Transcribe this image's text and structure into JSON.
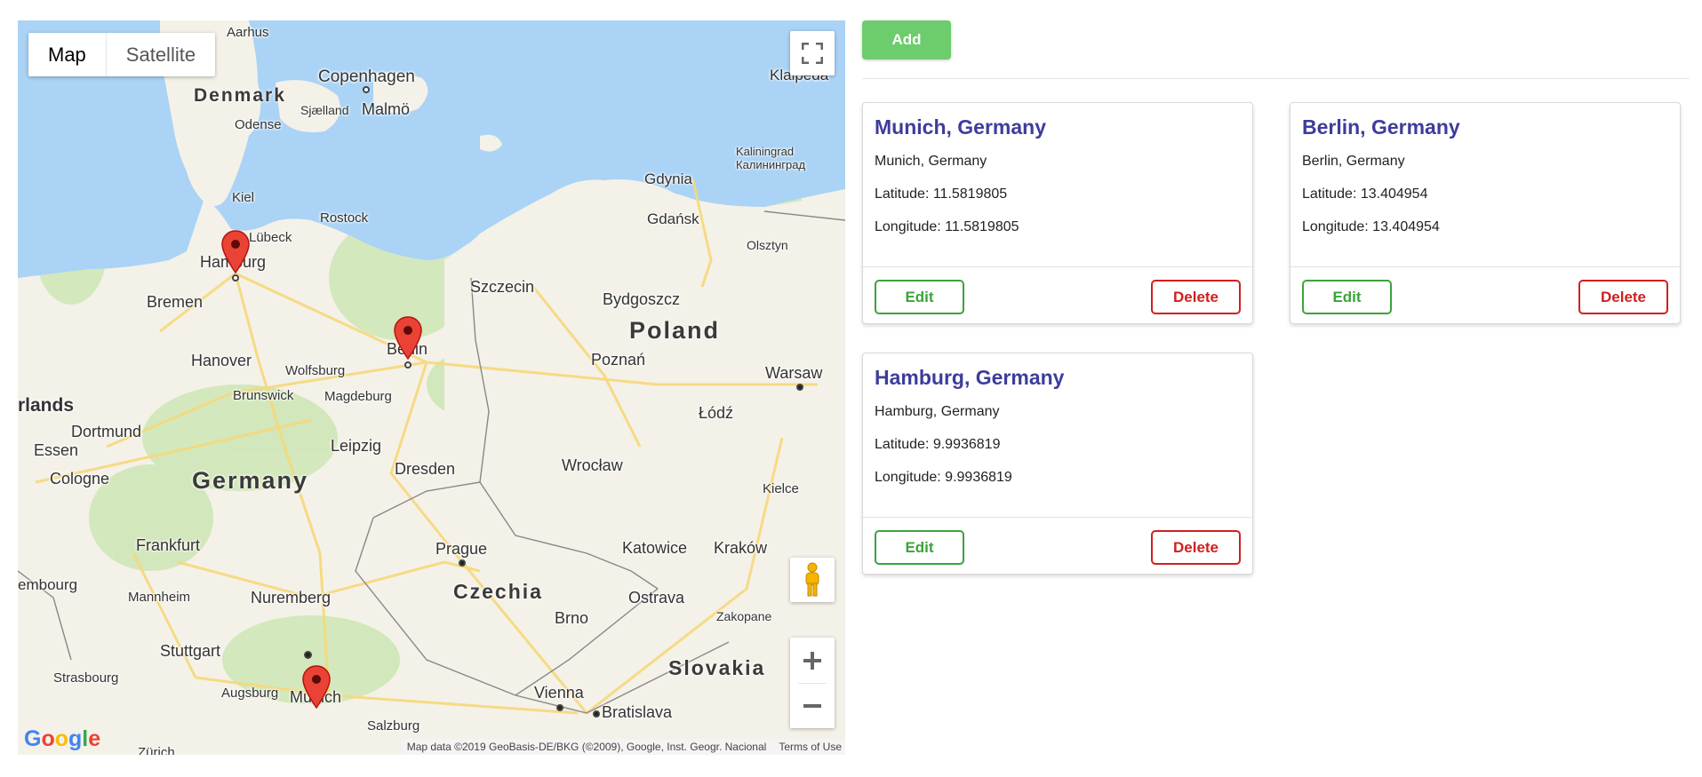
{
  "map": {
    "type_options": [
      "Map",
      "Satellite"
    ],
    "active_type": "Map",
    "country_labels": [
      "Denmark",
      "Poland",
      "Germany",
      "Czechia",
      "Slovakia"
    ],
    "city_labels": [
      "Aarhus",
      "Copenhagen",
      "Sjælland",
      "Malmö",
      "Odense",
      "Kiel",
      "Lübeck",
      "Rostock",
      "Hamburg",
      "Bremen",
      "Szczecin",
      "Bydgoszcz",
      "Gdynia",
      "Gdańsk",
      "Kaliningrad",
      "Калининград",
      "Olsztyn",
      "Klaipeda",
      "Hanover",
      "Wolfsburg",
      "Brunswick",
      "Magdeburg",
      "Berlin",
      "Poznań",
      "Warsaw",
      "rlands",
      "Dortmund",
      "Essen",
      "Łódź",
      "Leipzig",
      "Cologne",
      "Dresden",
      "Wrocław",
      "Kielce",
      "Frankfurt",
      "Prague",
      "Katowice",
      "Kraków",
      "embourg",
      "Mannheim",
      "Nuremberg",
      "Ostrava",
      "Brno",
      "Zakopane",
      "Stuttgart",
      "Strasbourg",
      "Augsburg",
      "Munich",
      "Vienna",
      "Bratislava",
      "Salzburg",
      "Zürich"
    ],
    "attribution": "Map data ©2019 GeoBasis-DE/BKG (©2009), Google, Inst. Geogr. Nacional",
    "terms": "Terms of Use",
    "logo": "Google",
    "markers": [
      "Hamburg",
      "Berlin",
      "Munich"
    ]
  },
  "toolbar": {
    "add_label": "Add"
  },
  "locations": [
    {
      "title": "Munich, Germany",
      "address": "Munich, Germany",
      "latitude": "Latitude: 11.5819805",
      "longitude": "Longitude: 11.5819805",
      "edit": "Edit",
      "delete": "Delete"
    },
    {
      "title": "Berlin, Germany",
      "address": "Berlin, Germany",
      "latitude": "Latitude: 13.404954",
      "longitude": "Longitude: 13.404954",
      "edit": "Edit",
      "delete": "Delete"
    },
    {
      "title": "Hamburg, Germany",
      "address": "Hamburg, Germany",
      "latitude": "Latitude: 9.9936819",
      "longitude": "Longitude: 9.9936819",
      "edit": "Edit",
      "delete": "Delete"
    }
  ],
  "colors": {
    "accent": "#3d3d9c",
    "add": "#6dcc6b",
    "edit": "#3aa43a",
    "delete": "#d01f1f",
    "marker": "#ea4335"
  }
}
